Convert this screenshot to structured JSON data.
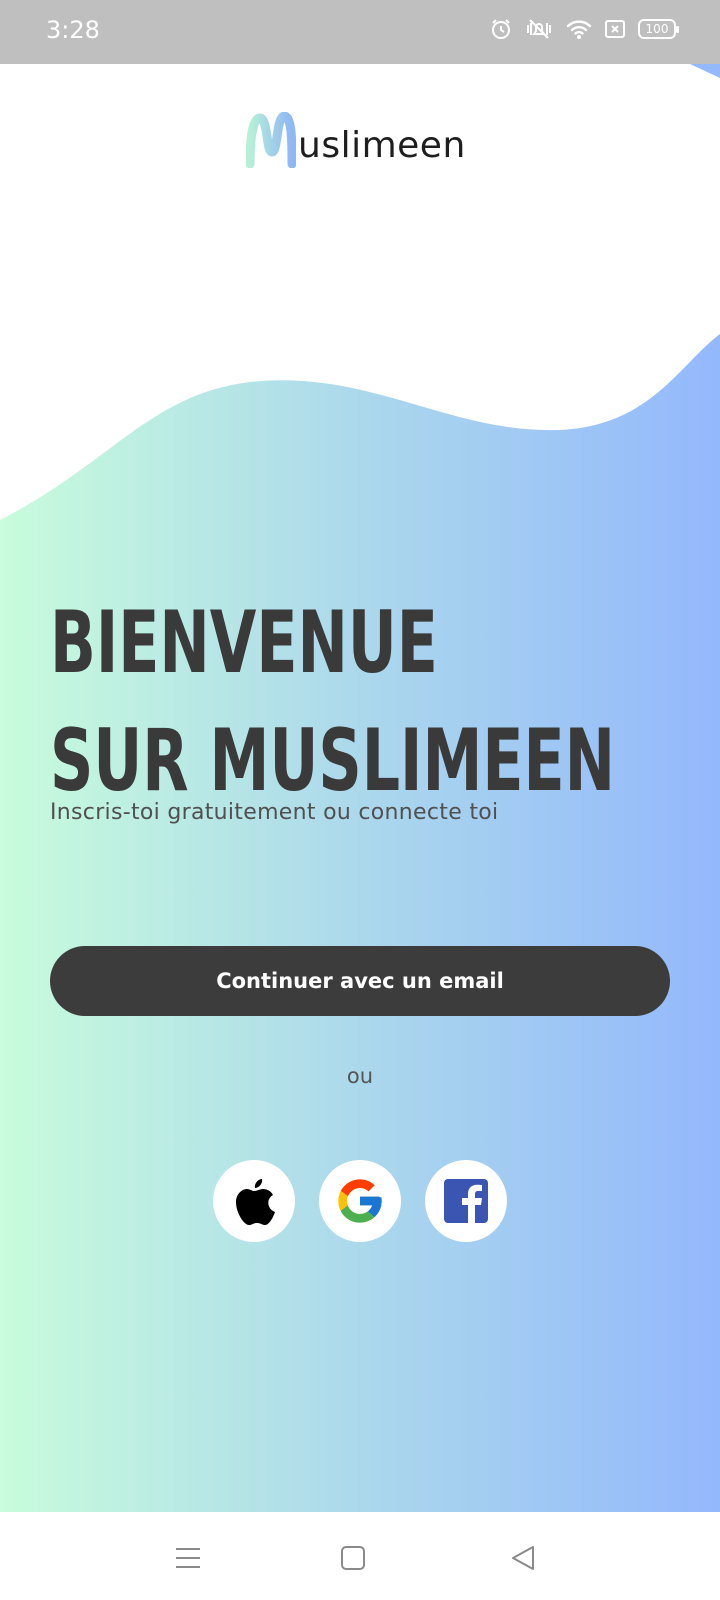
{
  "status_bar": {
    "time": "3:28",
    "battery": "100",
    "icons": [
      "alarm-icon",
      "vibrate-icon",
      "wifi-icon",
      "sim-off-icon",
      "battery-icon"
    ]
  },
  "logo": {
    "text": "uslimeen",
    "full_name": "Muslimeen"
  },
  "hero": {
    "line1": "BIENVENUE",
    "line2": "SUR MUSLIMEEN",
    "subtitle": "Inscris-toi gratuitement ou connecte toi"
  },
  "actions": {
    "email_label": "Continuer avec un email",
    "or_label": "ou",
    "social": [
      {
        "name": "apple-icon"
      },
      {
        "name": "google-icon"
      },
      {
        "name": "facebook-icon"
      }
    ]
  },
  "nav": {
    "icons": [
      "menu-icon",
      "home-icon",
      "back-icon"
    ]
  },
  "colors": {
    "gradient_left": "#c8fcdc",
    "gradient_mid": "#acd8ec",
    "gradient_right": "#94b8fc",
    "button": "#3c3c3c",
    "headline": "#3a3a3a"
  }
}
